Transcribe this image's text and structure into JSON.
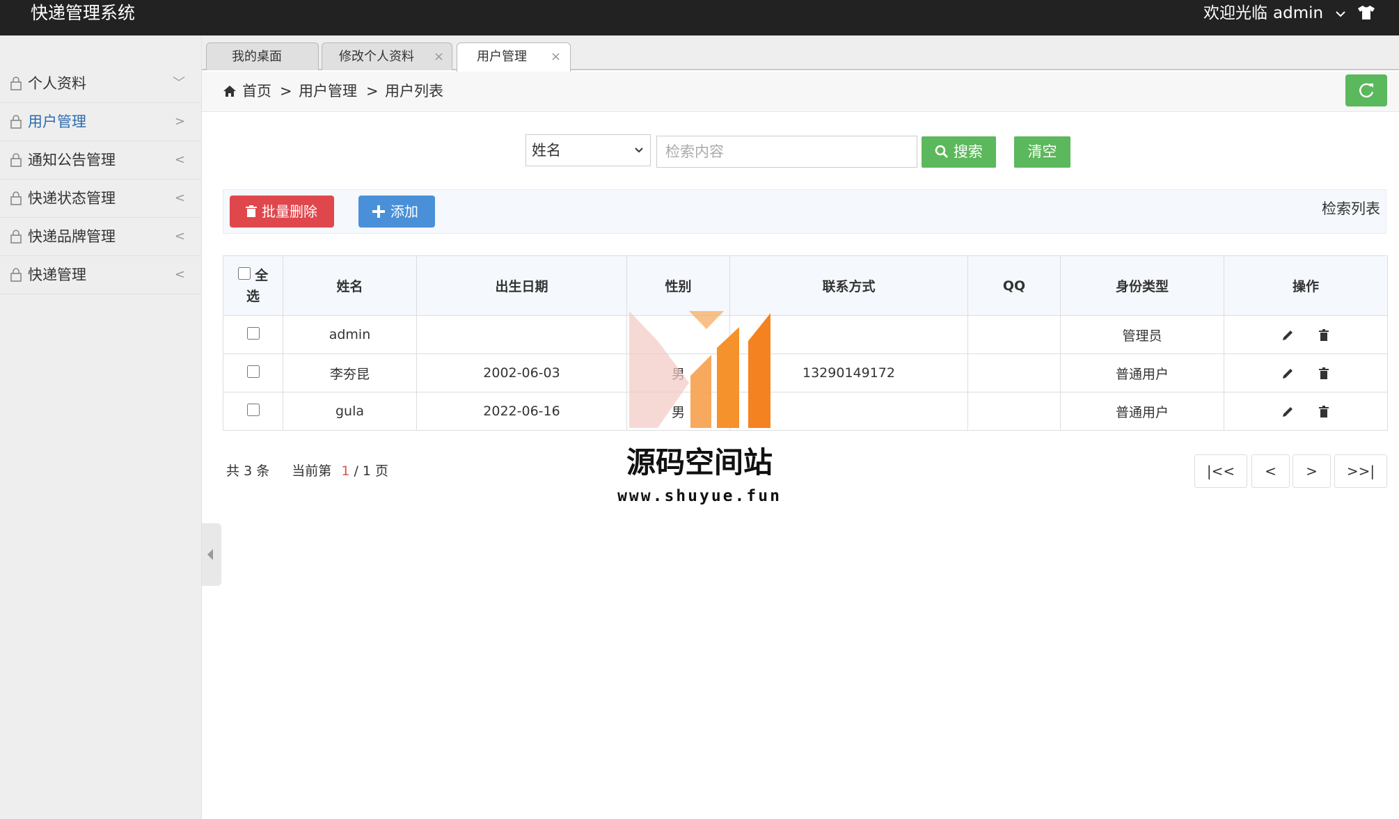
{
  "header": {
    "brand": "快递管理系统",
    "welcome": "欢迎光临",
    "username": "admin"
  },
  "sidebar": {
    "items": [
      {
        "label": "个人资料",
        "arrow": "﹀"
      },
      {
        "label": "用户管理",
        "arrow": ">"
      },
      {
        "label": "通知公告管理",
        "arrow": "<"
      },
      {
        "label": "快递状态管理",
        "arrow": "<"
      },
      {
        "label": "快递品牌管理",
        "arrow": "<"
      },
      {
        "label": "快递管理",
        "arrow": "<"
      }
    ]
  },
  "tabs": [
    {
      "label": "我的桌面",
      "close": ""
    },
    {
      "label": "修改个人资料",
      "close": "×"
    },
    {
      "label": "用户管理",
      "close": "×"
    }
  ],
  "breadcrumb": {
    "items": [
      "首页",
      "用户管理",
      "用户列表"
    ],
    "separator": ">"
  },
  "search": {
    "field_selected": "姓名",
    "placeholder": "检索内容",
    "search_label": "搜索",
    "clear_label": "清空"
  },
  "toolbar": {
    "batch_delete_label": "批量删除",
    "add_label": "添加",
    "right_label": "检索列表"
  },
  "table": {
    "select_all_top": "全",
    "select_all_bottom": "选",
    "columns": [
      "姓名",
      "出生日期",
      "性别",
      "联系方式",
      "QQ",
      "身份类型",
      "操作"
    ],
    "rows": [
      {
        "name": "admin",
        "birth": "",
        "gender": "",
        "contact": "",
        "qq": "",
        "role": "管理员"
      },
      {
        "name": "李夯昆",
        "birth": "2002-06-03",
        "gender": "男",
        "contact": "13290149172",
        "qq": "",
        "role": "普通用户"
      },
      {
        "name": "gula",
        "birth": "2022-06-16",
        "gender": "男",
        "contact": "",
        "qq": "",
        "role": "普通用户"
      }
    ]
  },
  "pagination": {
    "total_prefix": "共",
    "total": "3",
    "total_suffix": "条",
    "current_prefix": "当前第",
    "current": "1",
    "pages": "/ 1 页",
    "first": "|<<",
    "prev": "<",
    "next": ">",
    "last": ">>|"
  },
  "watermark": {
    "title": "源码空间站",
    "url": "www.shuyue.fun"
  },
  "colors": {
    "header_bg": "#222222",
    "green": "#5cb85c",
    "red": "#e0474c",
    "blue": "#4a90d9",
    "active_link": "#2b6cb0"
  }
}
